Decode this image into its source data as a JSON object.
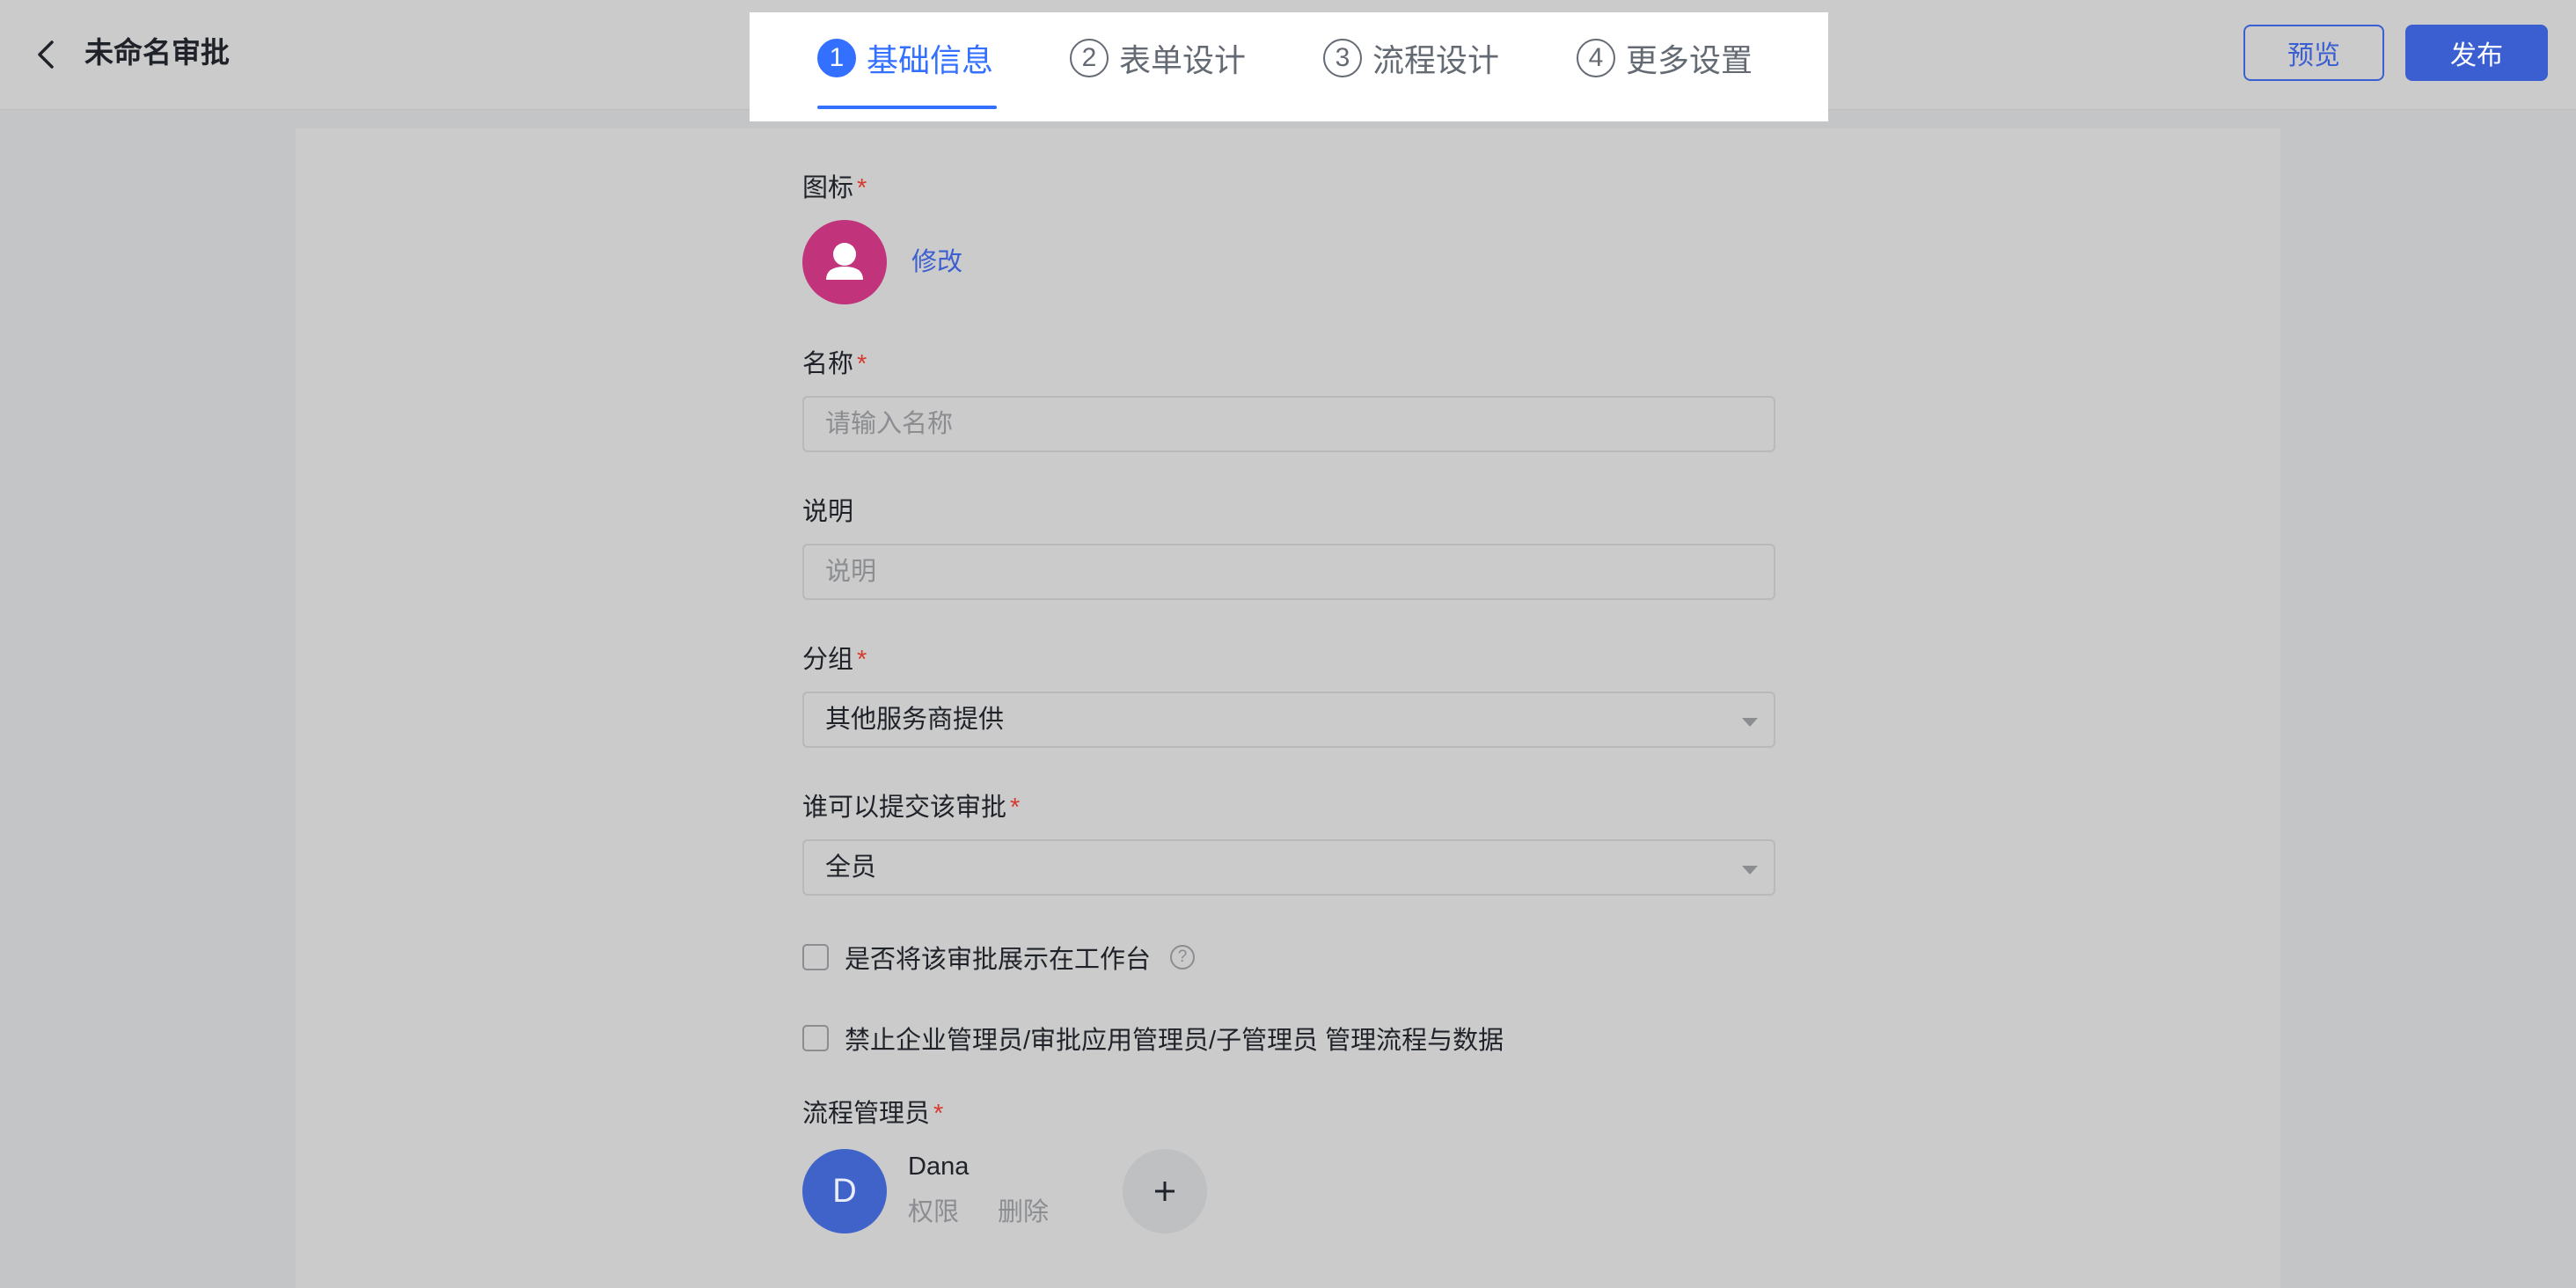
{
  "header": {
    "title": "未命名审批",
    "back_icon": "chevron-left-icon",
    "steps": [
      {
        "num": "1",
        "label": "基础信息",
        "active": true
      },
      {
        "num": "2",
        "label": "表单设计",
        "active": false
      },
      {
        "num": "3",
        "label": "流程设计",
        "active": false
      },
      {
        "num": "4",
        "label": "更多设置",
        "active": false
      }
    ],
    "preview_label": "预览",
    "publish_label": "发布"
  },
  "form": {
    "icon_label": "图标",
    "icon_modify": "修改",
    "icon_color": "#c1337a",
    "name_label": "名称",
    "name_placeholder": "请输入名称",
    "desc_label": "说明",
    "desc_placeholder": "说明",
    "group_label": "分组",
    "group_value": "其他服务商提供",
    "submitters_label": "谁可以提交该审批",
    "submitters_value": "全员",
    "show_workbench_label": "是否将该审批展示在工作台",
    "show_workbench_checked": false,
    "forbid_admin_label": "禁止企业管理员/审批应用管理员/子管理员 管理流程与数据",
    "forbid_admin_checked": false,
    "managers_label": "流程管理员",
    "managers": [
      {
        "initial": "D",
        "name": "Dana",
        "permission": "权限",
        "delete": "删除"
      }
    ],
    "required_mark": "*"
  },
  "colors": {
    "accent": "#3370ff",
    "primary_button": "#3b5fd0",
    "required": "#d83931"
  }
}
